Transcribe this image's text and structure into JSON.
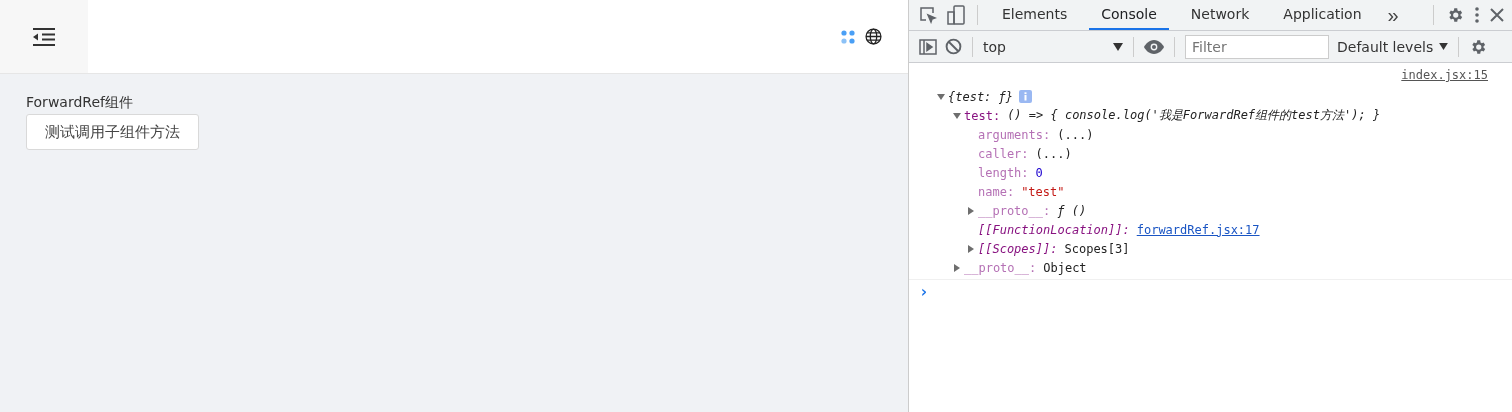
{
  "app": {
    "section_title": "ForwardRef组件",
    "button": "测试调用子组件方法"
  },
  "devtools": {
    "tabs": [
      {
        "label": "Elements",
        "selected": false
      },
      {
        "label": "Console",
        "selected": true
      },
      {
        "label": "Network",
        "selected": false
      },
      {
        "label": "Application",
        "selected": false
      }
    ],
    "more_tabs": "»",
    "context": "top",
    "filter_placeholder": "Filter",
    "levels": "Default levels",
    "source_link": "index.jsx:15",
    "root": {
      "label": "{test: ƒ}",
      "expanded": true,
      "children": [
        {
          "key": "test:",
          "inherited": false,
          "internal": false,
          "value": "() => { console.log('我是ForwardRef组件的test方法'); }",
          "kind": "preview",
          "expanded": true,
          "children": [
            {
              "key": "arguments:",
              "inherited": true,
              "internal": false,
              "value": "(...)",
              "kind": "plain"
            },
            {
              "key": "caller:",
              "inherited": true,
              "internal": false,
              "value": "(...)",
              "kind": "plain"
            },
            {
              "key": "length:",
              "inherited": true,
              "internal": false,
              "value": "0",
              "kind": "number"
            },
            {
              "key": "name:",
              "inherited": true,
              "internal": false,
              "value": "\"test\"",
              "kind": "string"
            },
            {
              "key": "__proto__:",
              "inherited": true,
              "internal": false,
              "value": "ƒ ()",
              "kind": "function",
              "expanded": false
            },
            {
              "key": "[[FunctionLocation]]:",
              "inherited": false,
              "internal": true,
              "value": "forwardRef.jsx:17",
              "kind": "link"
            },
            {
              "key": "[[Scopes]]:",
              "inherited": false,
              "internal": true,
              "value": "Scopes[3]",
              "kind": "plain",
              "expanded": false
            }
          ]
        },
        {
          "key": "__proto__:",
          "inherited": true,
          "internal": false,
          "value": "Object",
          "kind": "plain",
          "expanded": false
        }
      ]
    },
    "prompt": "›"
  }
}
